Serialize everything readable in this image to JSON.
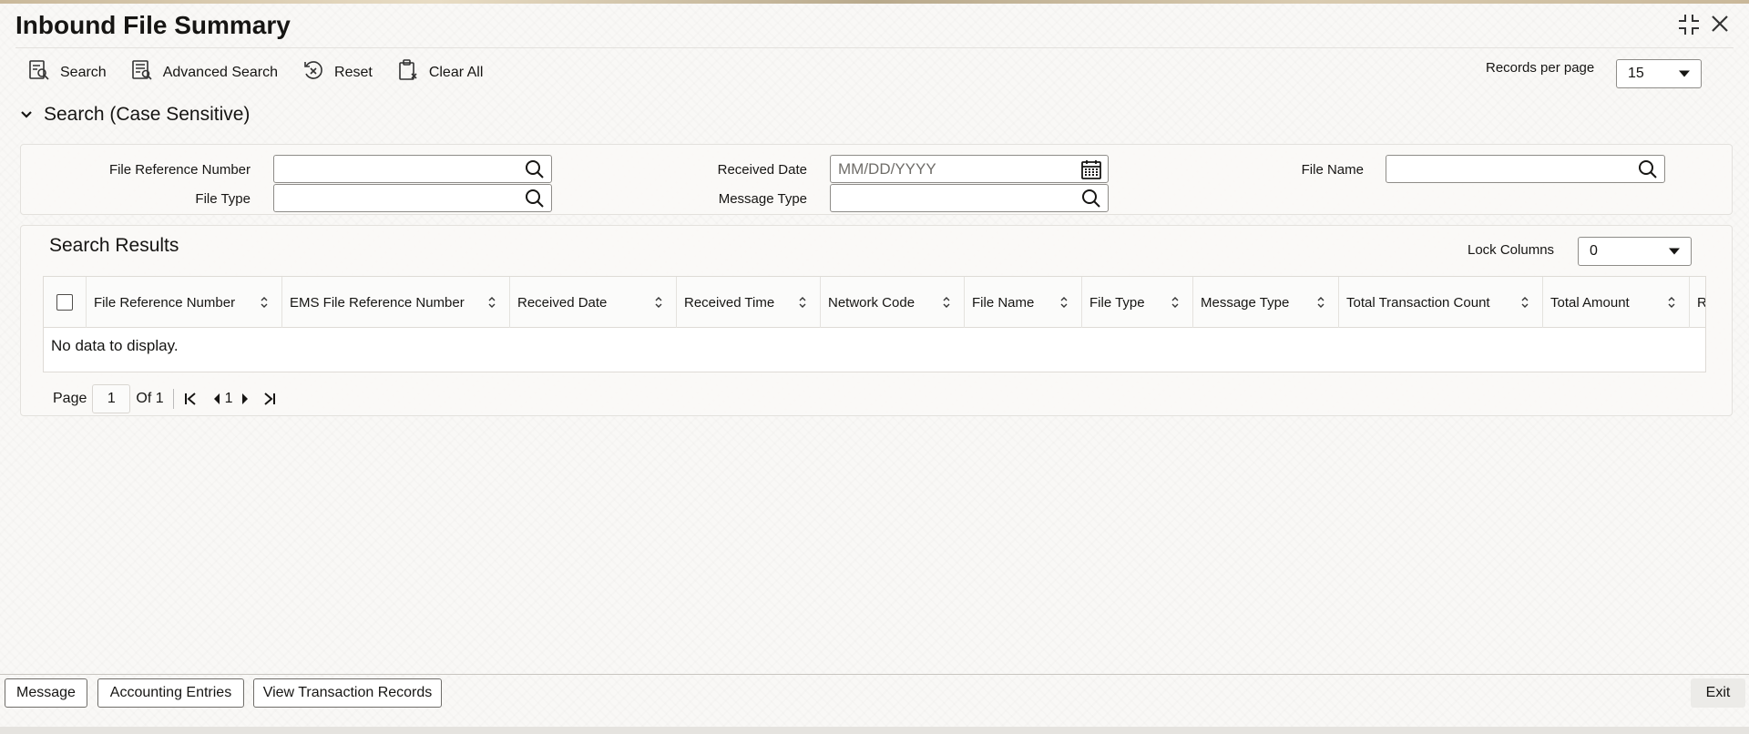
{
  "window": {
    "title": "Inbound File Summary"
  },
  "toolbar": {
    "search_label": "Search",
    "advanced_search_label": "Advanced Search",
    "reset_label": "Reset",
    "clear_all_label": "Clear All"
  },
  "records_per_page": {
    "label": "Records per page",
    "value": "15"
  },
  "search_section": {
    "title": "Search (Case Sensitive)",
    "fields": {
      "file_reference_number": {
        "label": "File Reference Number",
        "value": ""
      },
      "file_type": {
        "label": "File Type",
        "value": ""
      },
      "received_date": {
        "label": "Received Date",
        "placeholder": "MM/DD/YYYY"
      },
      "message_type": {
        "label": "Message Type",
        "value": ""
      },
      "file_name": {
        "label": "File Name",
        "value": ""
      }
    }
  },
  "results": {
    "title": "Search Results",
    "lock_columns": {
      "label": "Lock Columns",
      "value": "0"
    },
    "columns": [
      "File Reference Number",
      "EMS File Reference Number",
      "Received Date",
      "Received Time",
      "Network Code",
      "File Name",
      "File Type",
      "Message Type",
      "Total Transaction Count",
      "Total Amount",
      "Re"
    ],
    "empty_text": "No data to display."
  },
  "pagination": {
    "page_label": "Page",
    "page_value": "1",
    "of_label": "Of 1",
    "current": "1"
  },
  "footer": {
    "message_label": "Message",
    "accounting_entries_label": "Accounting Entries",
    "view_transaction_records_label": "View Transaction Records",
    "exit_label": "Exit"
  }
}
